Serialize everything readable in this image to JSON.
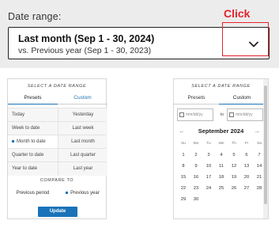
{
  "top": {
    "label": "Date range:",
    "click_note": "Click",
    "main": "Last month (Sep 1 - 30, 2024)",
    "sub": "vs. Previous year (Sep 1 - 30, 2023)"
  },
  "left_panel": {
    "title": "SELECT A DATE RANGE",
    "tabs": [
      "Presets",
      "Custom"
    ],
    "presets": [
      [
        "Today",
        "Yesterday"
      ],
      [
        "Week to date",
        "Last week"
      ],
      [
        "Month to date",
        "Last month"
      ],
      [
        "Quarter to date",
        "Last quarter"
      ],
      [
        "Year to date",
        "Last year"
      ]
    ],
    "compare_title": "COMPARE TO",
    "compare_options": [
      "Previous period",
      "Previous year"
    ],
    "update_label": "Update"
  },
  "right_panel": {
    "title": "SELECT A DATE RANGE",
    "tabs": [
      "Presets",
      "Custom"
    ],
    "from_placeholder": "mm/dd/yy",
    "to_label": "to",
    "to_placeholder": "mm/dd/yy",
    "month": "September 2024",
    "weekdays": [
      "Su",
      "Mo",
      "Tu",
      "We",
      "Th",
      "Fr",
      "Sa"
    ],
    "days": [
      "1",
      "2",
      "3",
      "4",
      "5",
      "6",
      "7",
      "8",
      "9",
      "10",
      "11",
      "12",
      "13",
      "14",
      "15",
      "16",
      "17",
      "18",
      "19",
      "20",
      "21",
      "22",
      "23",
      "24",
      "25",
      "26",
      "27",
      "28",
      "29",
      "30"
    ]
  },
  "colors": {
    "accent": "#1a73b9",
    "highlight": "#e4222b"
  }
}
